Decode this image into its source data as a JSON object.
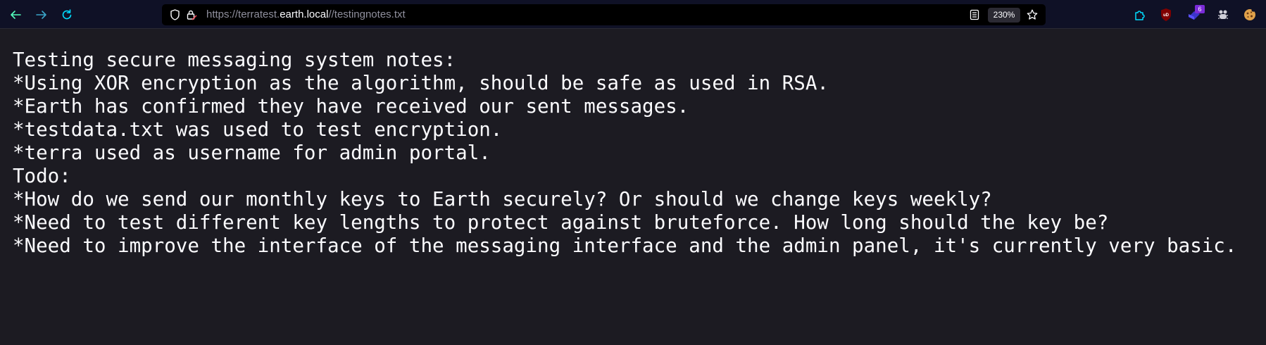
{
  "browser": {
    "url_prefix": "https://terratest.",
    "url_host": "earth.local",
    "url_suffix": "//testingnotes.txt",
    "zoom": "230%",
    "extension_badge": "6"
  },
  "document": {
    "lines": [
      "Testing secure messaging system notes:",
      "*Using XOR encryption as the algorithm, should be safe as used in RSA.",
      "*Earth has confirmed they have received our sent messages.",
      "*testdata.txt was used to test encryption.",
      "*terra used as username for admin portal.",
      "Todo:",
      "*How do we send our monthly keys to Earth securely? Or should we change keys weekly?",
      "*Need to test different key lengths to protect against bruteforce. How long should the key be?",
      "*Need to improve the interface of the messaging interface and the admin panel, it's currently very basic."
    ]
  },
  "icons": {
    "back": "arrow-left-icon",
    "forward": "arrow-right-icon",
    "reload": "reload-icon",
    "tracking": "shield-icon",
    "lock": "lock-icon",
    "reader": "reader-view-icon",
    "bookmark": "star-icon",
    "extensions": [
      "puzzle-icon",
      "ublock-icon",
      "extension-icon",
      "bug-icon",
      "cookie-icon"
    ]
  },
  "colors": {
    "toolbar_bg": "#0f1126",
    "page_bg": "#1c1b22",
    "text": "#fbfbfe",
    "accent": "#00ddff"
  }
}
